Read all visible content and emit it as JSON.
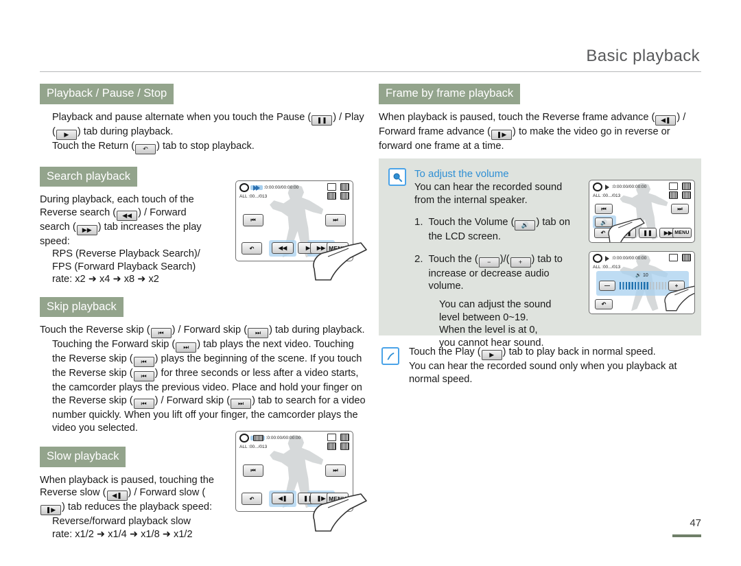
{
  "header": {
    "title": "Basic playback"
  },
  "footer": {
    "page_number": "47"
  },
  "left_column": {
    "sections": [
      {
        "heading": "Playback / Pause / Stop",
        "lines": [
          "Playback and pause alternate when you touch the Pause (",
          ") / Play (",
          ") tab during playback.",
          "Touch the Return (",
          ") tab to stop playback."
        ]
      },
      {
        "heading": "Search playback",
        "lines": [
          "During playback, each touch of the Reverse search (",
          ") / Forward search (",
          ") tab increases the play speed:",
          "RPS (Reverse Playback Search)/",
          "FPS (Forward Playback Search)",
          "rate: x2 ➜ x4 ➜ x8 ➜ x2"
        ]
      },
      {
        "heading": "Skip playback",
        "lines": [
          "Touch the Reverse skip (",
          ") / Forward skip (",
          ") tab during playback.",
          "Touching the Forward skip (",
          ") tab plays the next video.",
          "Touching the Reverse skip (",
          ") plays the beginning of the scene. If you touch the Reverse skip (",
          ") for three seconds or less after a video starts, the camcorder plays the previous video. Place and hold your finger on the Reverse skip (",
          ") / Forward skip (",
          ") tab to search for a video number quickly. When you lift off your finger, the camcorder plays the video you selected."
        ]
      },
      {
        "heading": "Slow playback",
        "lines": [
          "When playback is paused, touching the Reverse slow (",
          ") / Forward slow (",
          ") tab reduces the playback speed:",
          "Reverse/forward playback slow",
          "rate: x1/2 ➜ x1/4 ➜ x1/8 ➜ x1/2"
        ]
      }
    ]
  },
  "right_column": {
    "heading": "Frame by frame playback",
    "intro": [
      "When playback is paused, touch the Reverse frame advance (",
      ") / Forward frame advance (",
      ") to make the video go in reverse or forward one frame at a time."
    ],
    "note": {
      "icon": "magnifier-icon",
      "title": "To adjust the volume",
      "intro": "You can hear the recorded sound from the internal speaker.",
      "steps": [
        {
          "num": "1.",
          "a": "Touch the Volume (",
          "b": ") tab on the LCD screen."
        },
        {
          "num": "2.",
          "a": "Touch the (",
          "b": ")/(",
          "c": ") tab to increase or decrease audio volume."
        }
      ],
      "substep": [
        "You can adjust the sound",
        "level between  0~19.",
        "When the level is at  0,",
        "you cannot hear sound."
      ]
    },
    "tip": {
      "icon": "pen-note-icon",
      "lines": [
        "Touch the Play (",
        ") tab to play back in normal speed.",
        "You can hear the recorded sound only when you playback at normal speed."
      ]
    }
  },
  "lcd_screens": {
    "search": {
      "name": "search-playback-lcd",
      "osd_time": ":0:00:00/00:00:00",
      "osd_count": ":00.../013",
      "buttons": [
        "reverse-skip",
        "forward-skip",
        "return",
        "reverse-search",
        "play",
        "forward-search",
        "MENU"
      ],
      "menu_label": "MENU"
    },
    "slow": {
      "name": "slow-playback-lcd",
      "osd_time": ":0:00:00/00:00:00",
      "osd_count": ":00.../013",
      "menu_label": "MENU"
    },
    "volume_step1": {
      "name": "volume-step1-lcd",
      "osd_time": ":0:00:00/00:00:00",
      "osd_count": ":00.../013",
      "menu_label": "MENU"
    },
    "volume_step2": {
      "name": "volume-step2-lcd",
      "osd_time": ":0:00:00/00:00:00",
      "osd_count": ":00.../013",
      "minus_label": "—",
      "plus_label": "+",
      "level_label": "10"
    }
  },
  "colors": {
    "heading_band": "#93a48c",
    "note_panel": "#dfe3de",
    "note_accent": "#2f8fd4",
    "highlight": "#a8d0ef",
    "page_bar": "#6f7f68"
  }
}
